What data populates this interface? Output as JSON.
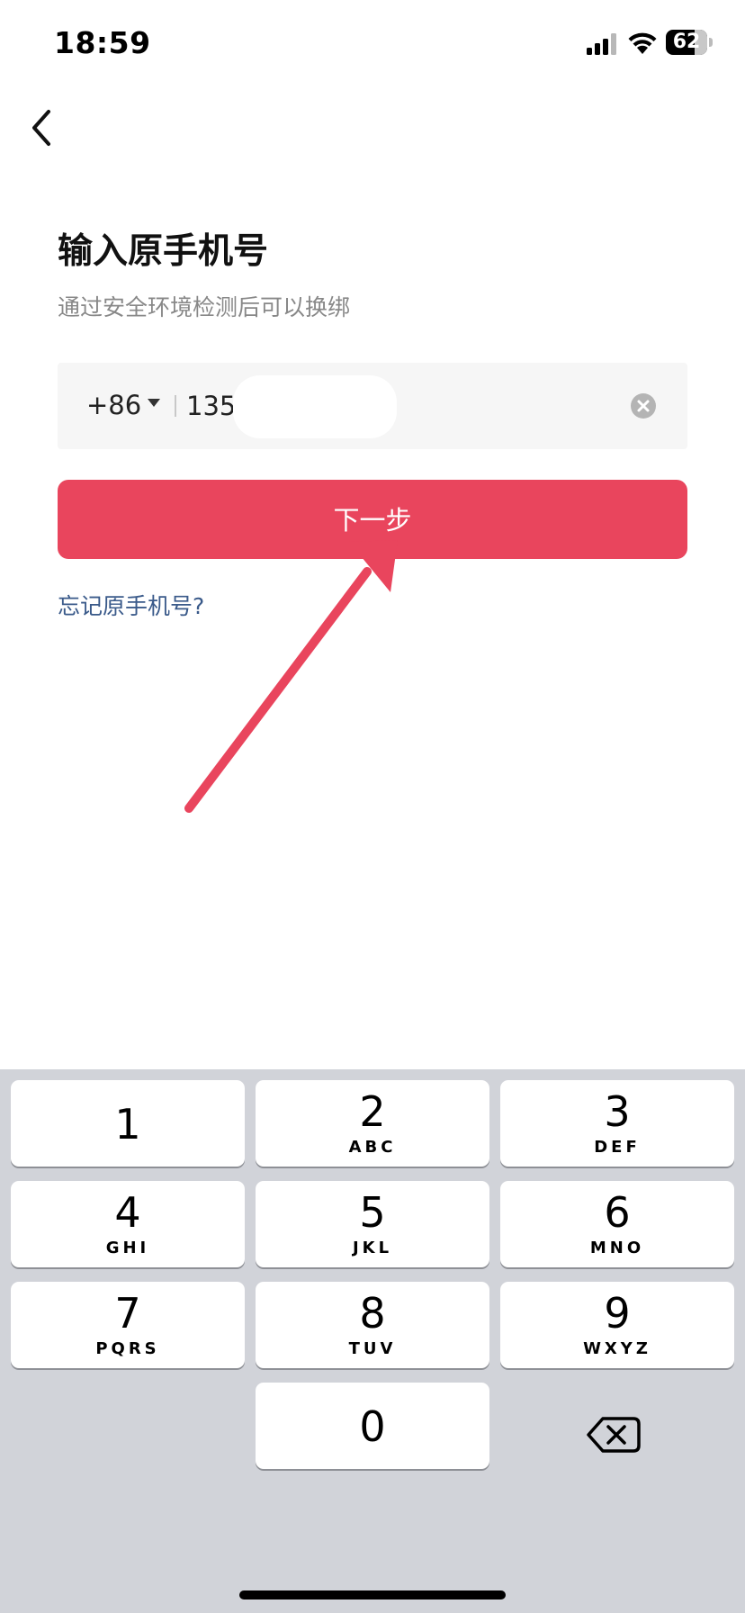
{
  "status_bar": {
    "time": "18:59",
    "battery": "62"
  },
  "page": {
    "title": "输入原手机号",
    "subtitle": "通过安全环境检测后可以换绑"
  },
  "phone": {
    "country_code": "+86",
    "value": "135"
  },
  "actions": {
    "next_label": "下一步",
    "forgot_label": "忘记原手机号?"
  },
  "keyboard": {
    "keys": [
      {
        "digit": "1",
        "letters": ""
      },
      {
        "digit": "2",
        "letters": "ABC"
      },
      {
        "digit": "3",
        "letters": "DEF"
      },
      {
        "digit": "4",
        "letters": "GHI"
      },
      {
        "digit": "5",
        "letters": "JKL"
      },
      {
        "digit": "6",
        "letters": "MNO"
      },
      {
        "digit": "7",
        "letters": "PQRS"
      },
      {
        "digit": "8",
        "letters": "TUV"
      },
      {
        "digit": "9",
        "letters": "WXYZ"
      },
      {
        "digit": "0",
        "letters": ""
      }
    ]
  },
  "colors": {
    "accent": "#e9455d",
    "link": "#3a5a8a",
    "annotation_arrow": "#e9455d",
    "keyboard_bg": "#d1d3d9"
  },
  "icons": [
    "back-chevron-icon",
    "signal-icon",
    "wifi-icon",
    "battery-icon",
    "dropdown-triangle-icon",
    "clear-icon",
    "delete-backspace-icon"
  ]
}
